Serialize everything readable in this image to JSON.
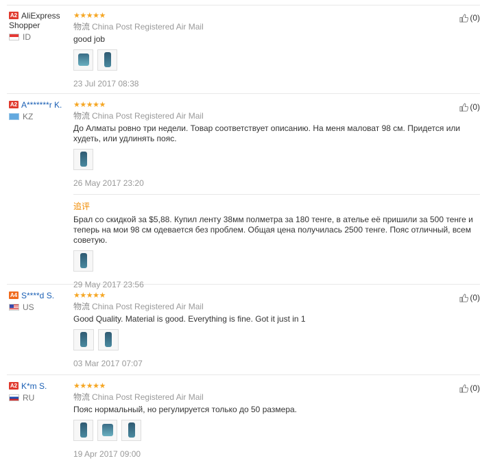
{
  "reviews": [
    {
      "badge": "A2",
      "name": "AliExpress Shopper",
      "country": "ID",
      "stars": "★★★★★",
      "shipping_cn": "物流",
      "shipping": "China Post Registered Air Mail",
      "text": "good job",
      "date": "23 Jul 2017 08:38",
      "likes": "(0)"
    },
    {
      "badge": "A2",
      "name": "A*******r K.",
      "country": "KZ",
      "stars": "★★★★★",
      "shipping_cn": "物流",
      "shipping": "China Post Registered Air Mail",
      "text": "До Алматы ровно три недели. Товар соответствует описанию. На меня маловат 98 см. Придется или худеть, или удлинять пояс.",
      "date": "26 May 2017 23:20",
      "likes": "(0)",
      "followup": {
        "title": "追评",
        "text": "Брал со скидкой за $5,88. Купил ленту 38мм полметра за 180 тенге, в ателье её пришили за 500 тенге и теперь на мои 98 см одевается без проблем. Общая цена получилась 2500 тенге. Пояс отличный, всем советую.",
        "date": "29 May 2017 23:56"
      }
    },
    {
      "badge": "A4",
      "name": "S****d S.",
      "country": "US",
      "stars": "★★★★★",
      "shipping_cn": "物流",
      "shipping": "China Post Registered Air Mail",
      "text": "Good Quality. Material is good. Everything is fine. Got it just in 1",
      "date": "03 Mar 2017 07:07",
      "likes": "(0)"
    },
    {
      "badge": "A2",
      "name": "K*m S.",
      "country": "RU",
      "stars": "★★★★★",
      "shipping_cn": "物流",
      "shipping": "China Post Registered Air Mail",
      "text": "Пояс нормальный, но регулируется только до 50 размера.",
      "date": "19 Apr 2017 09:00",
      "likes": "(0)"
    }
  ],
  "icons": {
    "like": "thumbs-up-icon",
    "flag": "country-flag-icon",
    "star": "star-icon"
  },
  "colors": {
    "star": "#f5a623",
    "badge": "#e03a2e",
    "followup": "#f08a00",
    "link": "#1a5fb4"
  }
}
